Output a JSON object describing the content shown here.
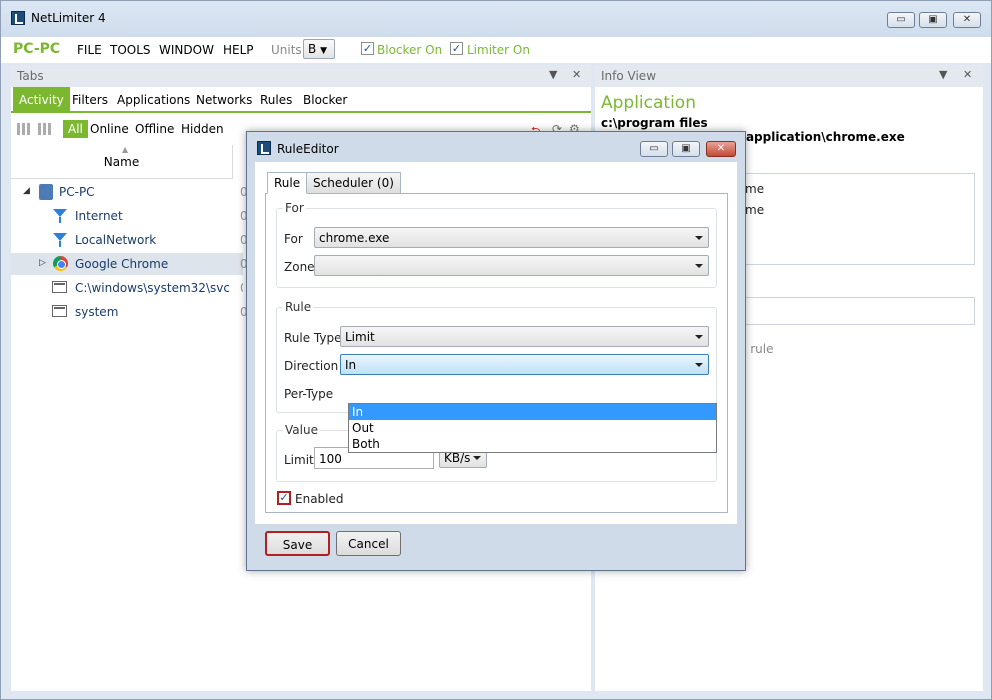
{
  "window": {
    "title": "NetLimiter 4",
    "min_glyph": "▭",
    "max_glyph": "▣",
    "close_glyph": "✕"
  },
  "menu": {
    "host": "PC-PC",
    "items": [
      "FILE",
      "TOOLS",
      "WINDOW",
      "HELP"
    ],
    "units_label": "Units",
    "units_value": "B",
    "blocker_label": "Blocker On",
    "limiter_label": "Limiter On"
  },
  "left_pane": {
    "title": "Tabs",
    "tabs": [
      "Activity",
      "Filters",
      "Applications",
      "Networks",
      "Rules",
      "Blocker"
    ],
    "filters": [
      "All",
      "Online",
      "Offline",
      "Hidden"
    ],
    "column_name": "Name",
    "tree": [
      {
        "label": "PC-PC",
        "val": "0"
      },
      {
        "label": "Internet",
        "val": "0"
      },
      {
        "label": "LocalNetwork",
        "val": "0"
      },
      {
        "label": "Google Chrome",
        "val": "0"
      },
      {
        "label": "C:\\windows\\system32\\svchos",
        "val": "0"
      },
      {
        "label": "system",
        "val": "0"
      }
    ]
  },
  "right_pane": {
    "title": "Info View",
    "app_heading": "Application",
    "path": "c:\\program files (x86)\\google\\chrome\\application\\chrome.exe",
    "frag1": "me",
    "frag2": "me",
    "frag3": "e rule"
  },
  "dialog": {
    "title": "RuleEditor",
    "tabs": [
      "Rule",
      "Scheduler (0)"
    ],
    "for_group": "For",
    "for_label": "For",
    "for_value": "chrome.exe",
    "zone_label": "Zone",
    "zone_value": "",
    "rule_group": "Rule",
    "rule_type_label": "Rule Type",
    "rule_type_value": "Limit",
    "direction_label": "Direction",
    "direction_value": "In",
    "direction_options": [
      "In",
      "Out",
      "Both"
    ],
    "per_type_label": "Per-Type",
    "value_group": "Value",
    "limit_label": "Limit",
    "limit_value": "100",
    "unit_value": "KB/s",
    "enabled_label": "Enabled",
    "save": "Save",
    "cancel": "Cancel"
  },
  "colors": {
    "accent": "#7cb82f",
    "selection": "#3399ff"
  }
}
